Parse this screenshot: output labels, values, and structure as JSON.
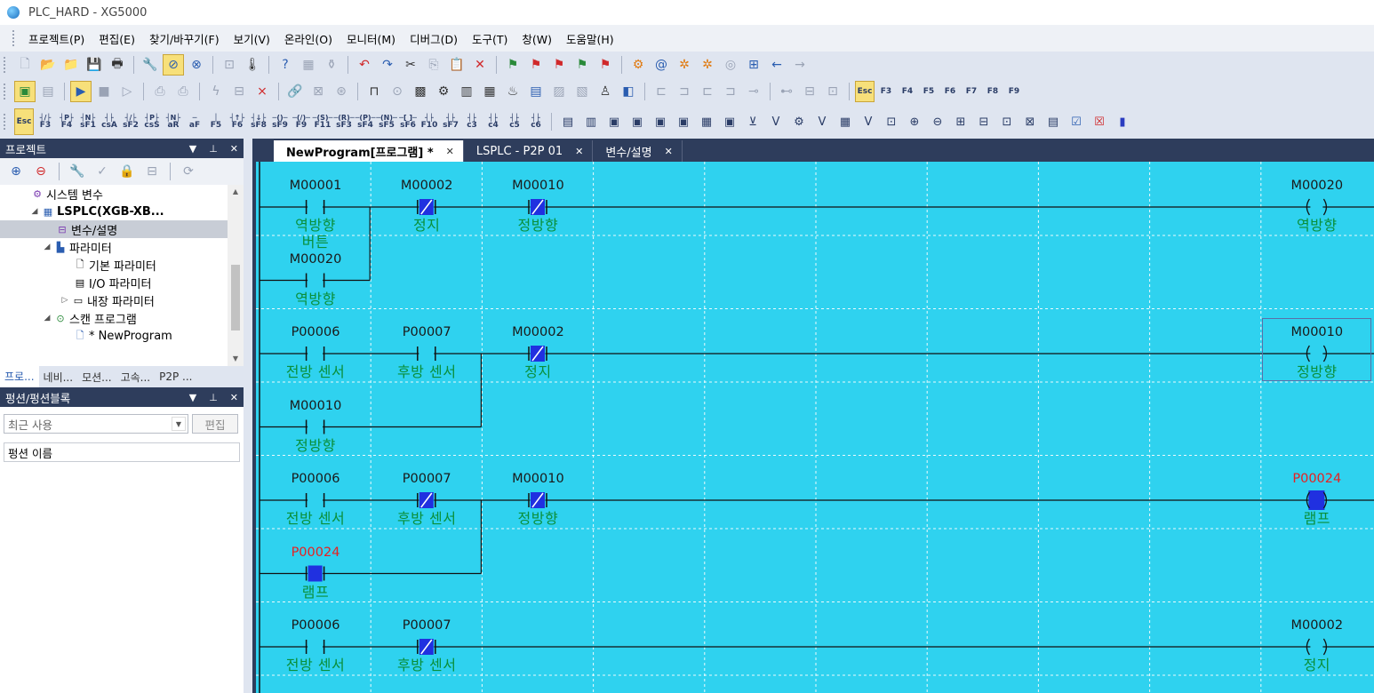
{
  "window": {
    "title": "PLC_HARD - XG5000"
  },
  "menu": [
    "프로젝트(P)",
    "편집(E)",
    "찾기/바꾸기(F)",
    "보기(V)",
    "온라인(O)",
    "모니터(M)",
    "디버그(D)",
    "도구(T)",
    "창(W)",
    "도움말(H)"
  ],
  "toolbar": {
    "row3_keys": [
      "Esc",
      "F3",
      "F4",
      "F5",
      "F6",
      "F7",
      "F8",
      "F9"
    ],
    "row4_keys": [
      "Esc",
      "F3",
      "F4",
      "sF1",
      "csA",
      "sF2",
      "csS",
      "aR",
      "aF",
      "F5",
      "F6",
      "sF8",
      "sF9",
      "F9",
      "F11",
      "sF3",
      "sF4",
      "sF5",
      "sF6",
      "F10",
      "sF7",
      "c3",
      "c4",
      "c5",
      "c6"
    ]
  },
  "project_pane": {
    "title": "프로젝트",
    "tree": [
      {
        "label": "시스템 변수",
        "bold": false
      },
      {
        "label": "LSPLC(XGB-XB...",
        "bold": true
      },
      {
        "label": "변수/설명",
        "bold": false
      },
      {
        "label": "파라미터",
        "bold": false
      },
      {
        "label": "기본 파라미터",
        "bold": false
      },
      {
        "label": "I/O 파라미터",
        "bold": false
      },
      {
        "label": "내장 파라미터",
        "bold": false
      },
      {
        "label": "스캔 프로그램",
        "bold": false
      },
      {
        "label": "* NewProgram",
        "bold": false
      }
    ],
    "bottom_tabs": [
      "프로...",
      "네비...",
      "모션...",
      "고속...",
      "P2P ..."
    ]
  },
  "function_pane": {
    "title": "펑션/펑션블록",
    "select_value": "최근 사용",
    "edit_label": "편집",
    "column_header": "펑션 이름"
  },
  "doc_tabs": [
    {
      "label": "NewProgram[프로그램] *",
      "active": true
    },
    {
      "label": "LSPLC - P2P 01",
      "active": false
    },
    {
      "label": "변수/설명",
      "active": false
    }
  ],
  "colors": {
    "ladder_bg": "#2fd2ef",
    "comment_green": "#0a8f3a",
    "address_red": "#e82020",
    "active_contact": "#2030e0",
    "panel_header": "#2e3d5c"
  },
  "ladder": {
    "elements": [
      {
        "row": 0,
        "col": 0,
        "type": "contact_no",
        "addr": "M00001",
        "comment": [
          "역방향",
          "버튼"
        ]
      },
      {
        "row": 0,
        "col": 1,
        "type": "contact_nc",
        "addr": "M00002",
        "comment": [
          "정지"
        ]
      },
      {
        "row": 0,
        "col": 2,
        "type": "contact_nc",
        "addr": "M00010",
        "comment": [
          "정방향"
        ]
      },
      {
        "row": 0,
        "col": 9,
        "type": "coil",
        "addr": "M00020",
        "comment": [
          "역방향"
        ]
      },
      {
        "row": 1,
        "col": 0,
        "type": "contact_no",
        "addr": "M00020",
        "comment": [
          "역방향"
        ]
      },
      {
        "row": 2,
        "col": 0,
        "type": "contact_no",
        "addr": "P00006",
        "comment": [
          "전방 센서"
        ]
      },
      {
        "row": 2,
        "col": 1,
        "type": "contact_no",
        "addr": "P00007",
        "comment": [
          "후방 센서"
        ]
      },
      {
        "row": 2,
        "col": 2,
        "type": "contact_nc",
        "addr": "M00002",
        "comment": [
          "정지"
        ]
      },
      {
        "row": 2,
        "col": 9,
        "type": "coil",
        "addr": "M00010",
        "comment": [
          "정방향"
        ],
        "selected": true
      },
      {
        "row": 3,
        "col": 0,
        "type": "contact_no",
        "addr": "M00010",
        "comment": [
          "정방향"
        ]
      },
      {
        "row": 4,
        "col": 0,
        "type": "contact_no",
        "addr": "P00006",
        "comment": [
          "전방 센서"
        ]
      },
      {
        "row": 4,
        "col": 1,
        "type": "contact_nc",
        "addr": "P00007",
        "comment": [
          "후방 센서"
        ]
      },
      {
        "row": 4,
        "col": 2,
        "type": "contact_nc",
        "addr": "M00010",
        "comment": [
          "정방향"
        ]
      },
      {
        "row": 4,
        "col": 9,
        "type": "coil_on",
        "addr": "P00024",
        "comment": [
          "램프"
        ],
        "red": true
      },
      {
        "row": 5,
        "col": 0,
        "type": "contact_on",
        "addr": "P00024",
        "comment": [
          "램프"
        ],
        "red": true
      },
      {
        "row": 6,
        "col": 0,
        "type": "contact_no",
        "addr": "P00006",
        "comment": [
          "전방 센서"
        ]
      },
      {
        "row": 6,
        "col": 1,
        "type": "contact_nc",
        "addr": "P00007",
        "comment": [
          "후방 센서"
        ]
      },
      {
        "row": 6,
        "col": 9,
        "type": "coil",
        "addr": "M00002",
        "comment": [
          "정지"
        ]
      }
    ],
    "branches": [
      {
        "from_row": 0,
        "to_row": 1,
        "after_col": 0
      },
      {
        "from_row": 2,
        "to_row": 3,
        "after_col": 1
      },
      {
        "from_row": 4,
        "to_row": 5,
        "after_col": 1
      }
    ],
    "main_rows": [
      0,
      2,
      4,
      6
    ]
  }
}
